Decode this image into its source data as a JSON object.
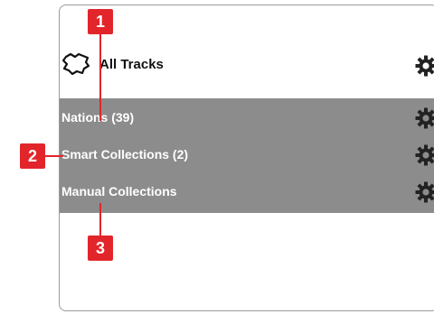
{
  "header": {
    "all_tracks_label": "All Tracks"
  },
  "groups": [
    {
      "label": "Nations  (39)"
    },
    {
      "label": "Smart Collections  (2)"
    },
    {
      "label": "Manual Collections"
    }
  ],
  "callouts": [
    "1",
    "2",
    "3"
  ],
  "colors": {
    "group_band": "#8c8c8c",
    "callout": "#e2252b"
  },
  "icons": {
    "header_icon": "map-icon",
    "settings_icon": "gear-icon"
  }
}
